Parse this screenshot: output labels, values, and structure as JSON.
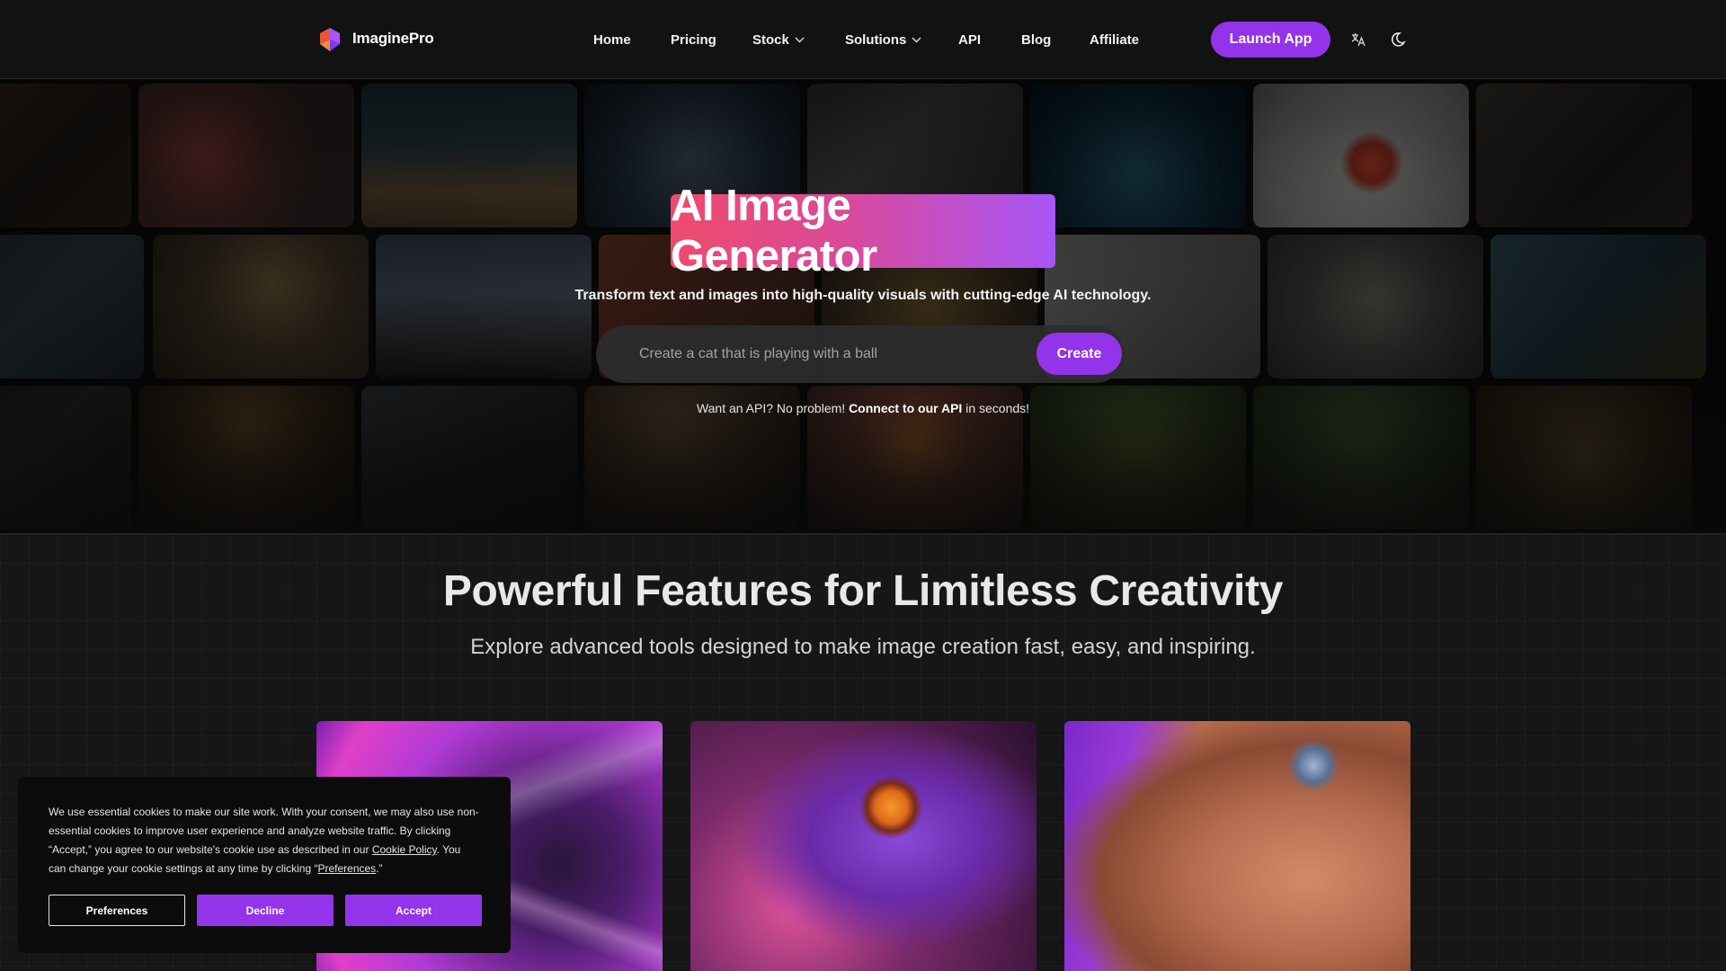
{
  "brand": {
    "name": "ImaginePro"
  },
  "nav": {
    "items": [
      {
        "label": "Home",
        "dropdown": false
      },
      {
        "label": "Pricing",
        "dropdown": false
      },
      {
        "label": "Stock",
        "dropdown": true
      },
      {
        "label": "Solutions",
        "dropdown": true
      },
      {
        "label": "API",
        "dropdown": false
      },
      {
        "label": "Blog",
        "dropdown": false
      },
      {
        "label": "Affiliate",
        "dropdown": false
      }
    ],
    "launch_label": "Launch App",
    "icons": [
      "translate-icon",
      "moon-icon"
    ]
  },
  "hero": {
    "title": "AI Image Generator",
    "subtitle": "Transform text and images into high-quality visuals with cutting-edge AI technology.",
    "prompt_placeholder": "Create a cat that is playing with a ball",
    "create_label": "Create",
    "api_pre": "Want an API? No problem! ",
    "api_link": "Connect to our API",
    "api_post": " in seconds!"
  },
  "features": {
    "title": "Powerful Features for Limitless Creativity",
    "subtitle": "Explore advanced tools designed to make image creation fast, easy, and inspiring."
  },
  "cookie": {
    "text_1": "We use essential cookies to make our site work. With your consent, we may also use non-essential cookies to improve user experience and analyze website traffic. By clicking “Accept,” you agree to our website's cookie use as described in our ",
    "policy_link": "Cookie Policy",
    "text_2": ". You can change your cookie settings at any time by clicking “",
    "prefs_link": "Preferences",
    "text_3": ".”",
    "preferences_label": "Preferences",
    "decline_label": "Decline",
    "accept_label": "Accept"
  },
  "colors": {
    "accent": "#9333ea",
    "gradient_start": "#ef4a6c",
    "gradient_end": "#a855f7",
    "background": "#141414"
  }
}
